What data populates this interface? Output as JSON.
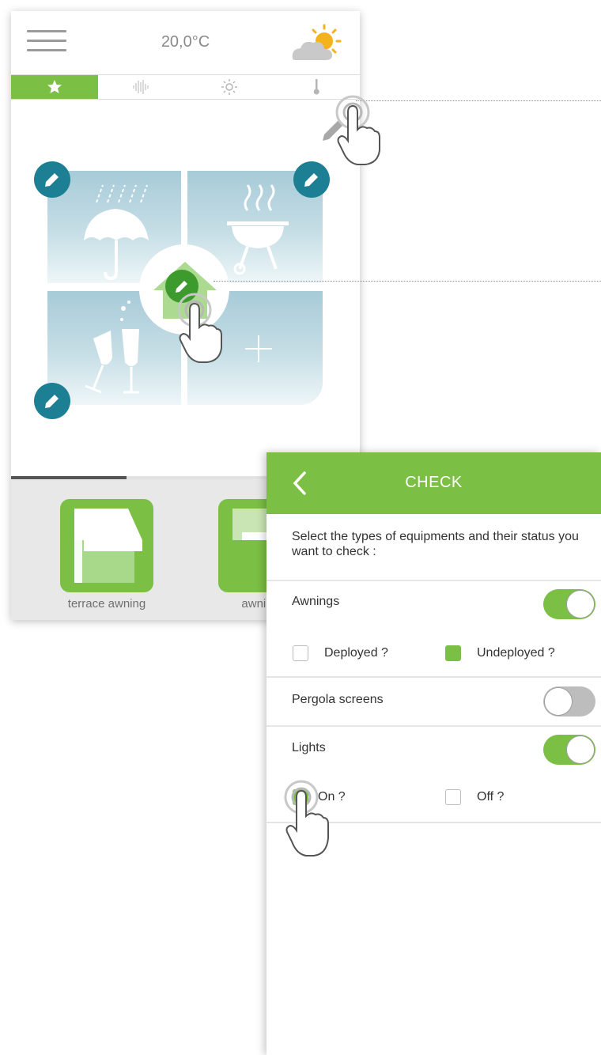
{
  "phone": {
    "header": {
      "temperature": "20,0°C",
      "menu_icon": "hamburger-icon",
      "weather_icon": "partly-sunny-icon"
    },
    "tabs": [
      {
        "name": "favorites",
        "icon": "star-icon",
        "active": true
      },
      {
        "name": "sound",
        "icon": "waveform-icon",
        "active": false
      },
      {
        "name": "sun",
        "icon": "sun-icon",
        "active": false
      },
      {
        "name": "temperature",
        "icon": "thermometer-icon",
        "active": false
      }
    ],
    "scenes": [
      {
        "name": "rain",
        "icon": "umbrella-rain-icon"
      },
      {
        "name": "barbecue",
        "icon": "barbecue-icon"
      },
      {
        "name": "party",
        "icon": "champagne-glasses-icon"
      },
      {
        "name": "add",
        "icon": "plus-icon"
      }
    ],
    "carousel_progress": 0.33,
    "devices": [
      {
        "name": "terrace awning",
        "icon": "awning-icon"
      },
      {
        "name": "awning v",
        "icon": "awning-icon"
      }
    ]
  },
  "check": {
    "title": "CHECK",
    "intro": "Select the types of equipments and their status you want to check :",
    "rows": [
      {
        "label": "Awnings",
        "enabled": true,
        "options": [
          {
            "label": "Deployed ?",
            "checked": false
          },
          {
            "label": "Undeployed ?",
            "checked": true
          }
        ]
      },
      {
        "label": "Pergola screens",
        "enabled": false,
        "options": []
      },
      {
        "label": "Lights",
        "enabled": true,
        "options": [
          {
            "label": "On ?",
            "checked": true
          },
          {
            "label": "Off ?",
            "checked": false
          }
        ]
      }
    ]
  },
  "colors": {
    "accent_green": "#7bbf44",
    "edit_badge": "#1d7f94",
    "tile_gradient_top": "#a7cbd8"
  }
}
